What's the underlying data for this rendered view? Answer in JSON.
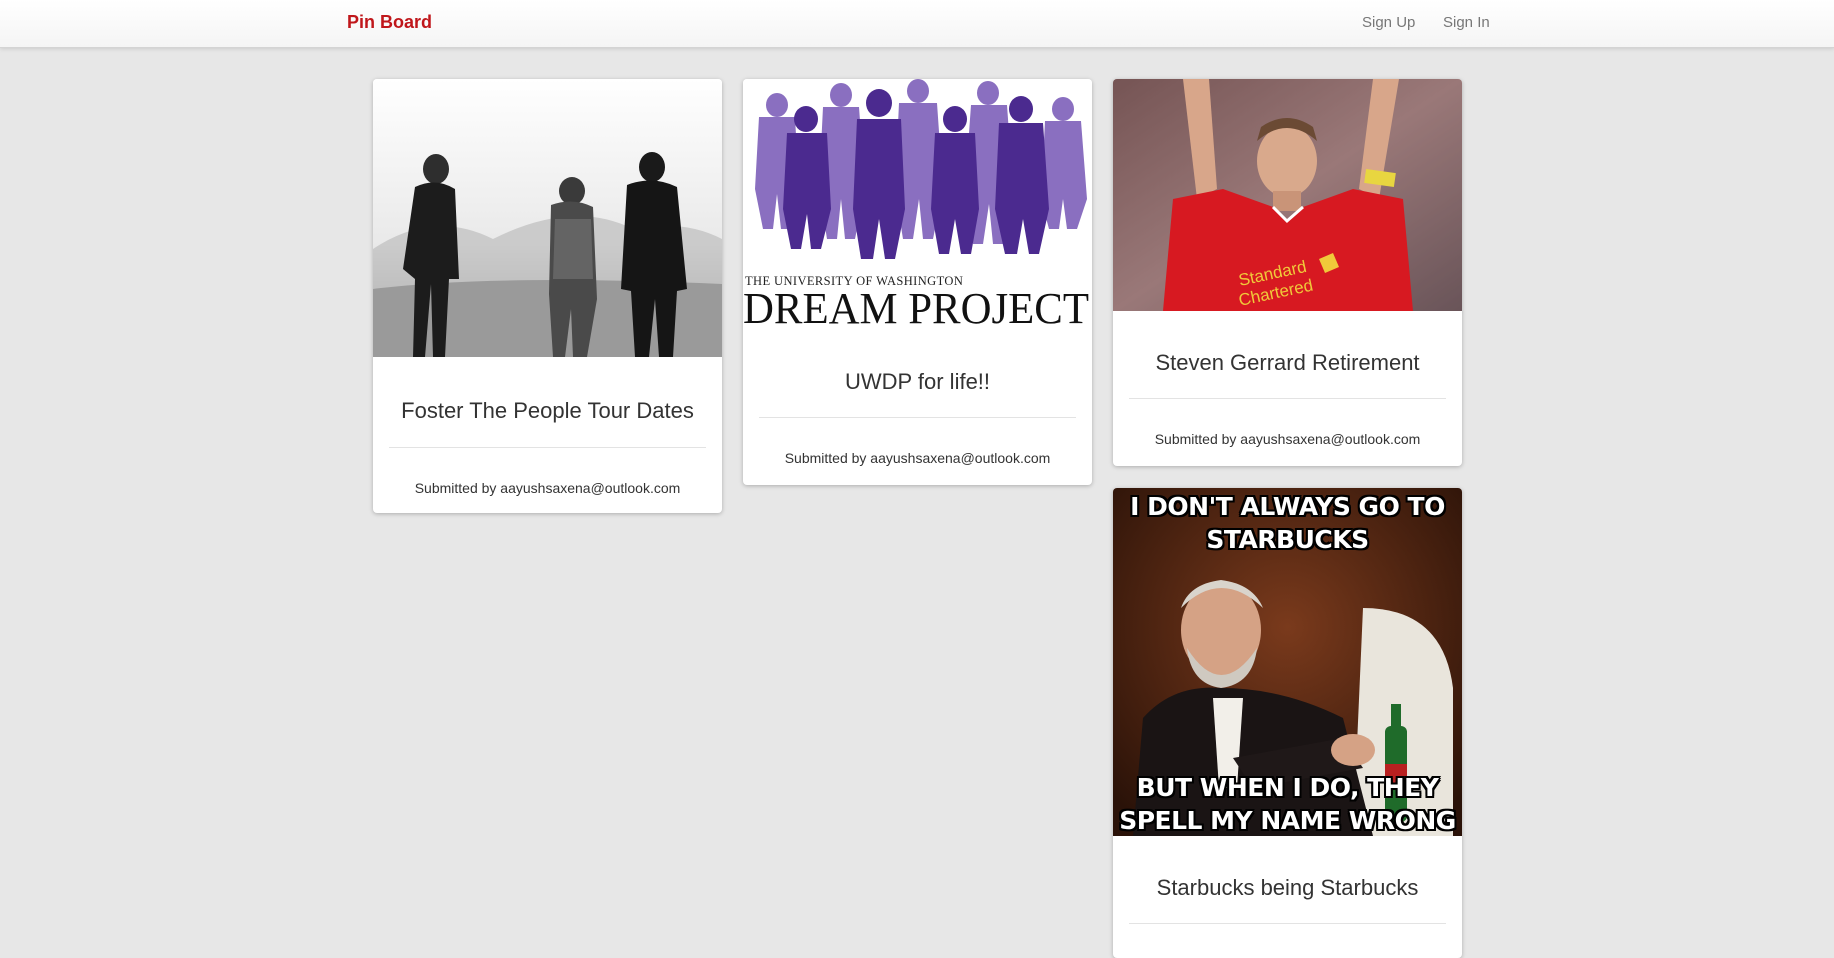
{
  "navbar": {
    "brand": "Pin Board",
    "sign_up": "Sign Up",
    "sign_in": "Sign In"
  },
  "pins": [
    {
      "image": "band-photo",
      "title": "Foster The People Tour Dates",
      "submitted_by": "Submitted by aayushsaxena@outlook.com"
    },
    {
      "image": "dream-project-logo",
      "logo_line1": "THE UNIVERSITY OF WASHINGTON",
      "logo_line2": "DREAM PROJECT",
      "title": "UWDP for life!!",
      "submitted_by": "Submitted by aayushsaxena@outlook.com"
    },
    {
      "image": "footballer-photo",
      "title": "Steven Gerrard Retirement",
      "submitted_by": "Submitted by aayushsaxena@outlook.com"
    },
    {
      "image": "meme-image",
      "meme_top": "I DON'T ALWAYS GO TO STARBUCKS",
      "meme_bottom": "BUT WHEN I DO, THEY SPELL MY NAME WRONG",
      "title": "Starbucks being Starbucks"
    }
  ],
  "colors": {
    "brand": "#c0171b",
    "background": "#e7e7e7",
    "card": "#ffffff",
    "purple_dark": "#4b2a8f",
    "purple_light": "#8a6fc0"
  }
}
